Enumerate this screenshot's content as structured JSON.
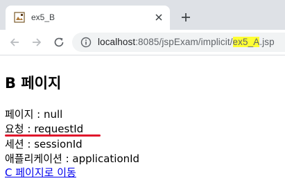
{
  "browser": {
    "tab": {
      "title": "ex5_B",
      "favicon": "image-doc-icon"
    },
    "new_tab_icon": "plus-icon",
    "toolbar": {
      "back_icon": "back-arrow-icon",
      "forward_icon": "forward-arrow-icon",
      "reload_icon": "reload-icon",
      "info_icon": "info-icon"
    },
    "address": {
      "host": "localhost",
      "port_path": ":8085/jspExam/implicit/",
      "highlighted": "ex5_A",
      "extension": ".jsp"
    },
    "highlight_color": "#ffff33"
  },
  "page": {
    "heading": "B 페이지",
    "lines": [
      "페이지 : null",
      "요청 : requestId",
      "세션 : sessionId",
      "애플리케이션 : applicationId"
    ],
    "link": "C 페이지로 이동"
  },
  "annotation": {
    "type": "red-underline",
    "color": "#e0102a"
  }
}
